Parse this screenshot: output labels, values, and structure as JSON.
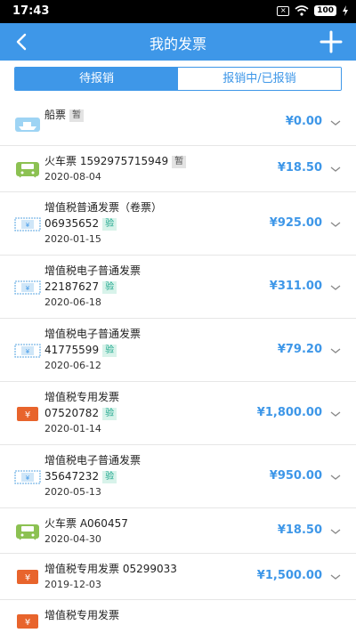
{
  "statusbar": {
    "time": "17:43",
    "sim_label": "×",
    "battery": "100"
  },
  "header": {
    "title": "我的发票"
  },
  "tabs": [
    {
      "label": "待报销",
      "active": true
    },
    {
      "label": "报销中/已报销",
      "active": false
    }
  ],
  "invoices": [
    {
      "type": "ship",
      "title": "船票",
      "number": "",
      "badge": "暂",
      "date": "",
      "amount": "¥0.00"
    },
    {
      "type": "train",
      "title": "火车票",
      "number": "1592975715949",
      "badge": "暂",
      "date": "2020-08-04",
      "amount": "¥18.50"
    },
    {
      "type": "vat-roll",
      "title": "增值税普通发票（卷票）",
      "number": "06935652",
      "badge": "验",
      "date": "2020-01-15",
      "amount": "¥925.00"
    },
    {
      "type": "vat-electronic",
      "title": "增值税电子普通发票",
      "number": "22187627",
      "badge": "验",
      "date": "2020-06-18",
      "amount": "¥311.00"
    },
    {
      "type": "vat-electronic",
      "title": "增值税电子普通发票",
      "number": "41775599",
      "badge": "验",
      "date": "2020-06-12",
      "amount": "¥79.20"
    },
    {
      "type": "vat-special",
      "title": "增值税专用发票",
      "number": "07520782",
      "badge": "验",
      "date": "2020-01-14",
      "amount": "¥1,800.00"
    },
    {
      "type": "vat-electronic",
      "title": "增值税电子普通发票",
      "number": "35647232",
      "badge": "验",
      "date": "2020-05-13",
      "amount": "¥950.00"
    },
    {
      "type": "train",
      "title": "火车票",
      "number": "A060457",
      "badge": "",
      "date": "2020-04-30",
      "amount": "¥18.50"
    },
    {
      "type": "vat-special",
      "title": "增值税专用发票",
      "number": "05299033",
      "badge": "",
      "date": "2019-12-03",
      "amount": "¥1,500.00"
    },
    {
      "type": "vat-special",
      "title": "增值税专用发票",
      "number": "",
      "badge": "",
      "date": "",
      "amount": ""
    }
  ],
  "colors": {
    "primary": "#3e97e8",
    "verify": "#18a48a",
    "special_icon": "#e8642c",
    "train_icon": "#8cc152"
  }
}
